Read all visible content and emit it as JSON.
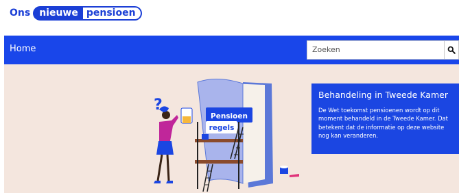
{
  "logo": {
    "part1": "Ons",
    "part2": "nieuwe",
    "part3": "pensioen"
  },
  "nav": {
    "home_label": "Home"
  },
  "search": {
    "placeholder": "Zoeken",
    "icon": "search-icon"
  },
  "hero": {
    "illustration": {
      "question_mark": "?",
      "sign_line1": "Pensioen",
      "sign_line2": "regels"
    },
    "panel": {
      "title": "Behandeling in Tweede Kamer",
      "text": "De Wet toekomst pensioenen wordt op dit moment behandeld in de Tweede Kamer. Dat betekent dat de informatie op deze website nog kan veranderen."
    }
  },
  "colors": {
    "brand_blue": "#1946ea",
    "hero_background": "#f4e6de",
    "panel_blue": "#1b46e2"
  }
}
